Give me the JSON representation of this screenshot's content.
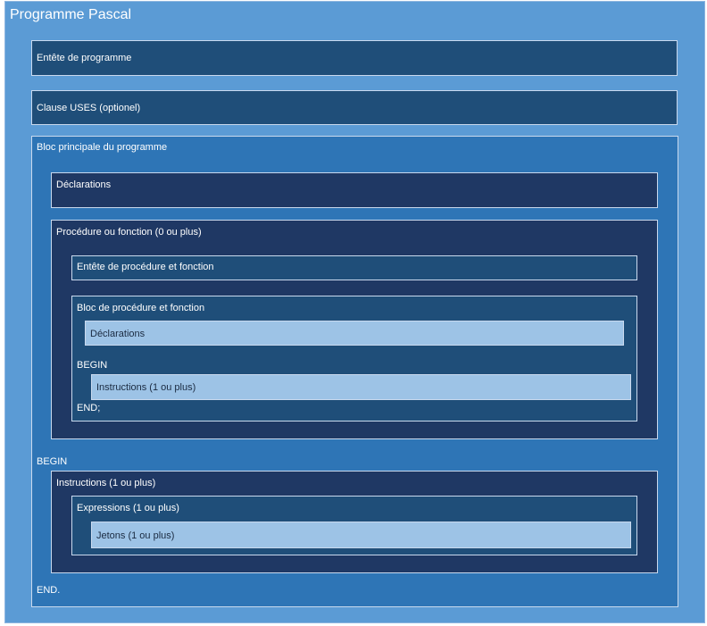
{
  "diagram": {
    "title": "Programme Pascal",
    "program_header": "Entête de programme",
    "uses_clause": "Clause USES (optionel)",
    "main_block": {
      "label": "Bloc principale du programme",
      "declarations": "Déclarations",
      "procedure": {
        "label": "Procédure ou fonction  (0 ou plus)",
        "header": "Entête de procédure et fonction",
        "block": {
          "label": "Bloc de procédure et fonction",
          "declarations": "Déclarations",
          "begin": "BEGIN",
          "instructions": "Instructions (1 ou plus)",
          "end": "END;"
        }
      },
      "begin": "BEGIN",
      "instructions": {
        "label": "Instructions (1 ou plus)",
        "expressions": {
          "label": "Expressions (1 ou plus)",
          "tokens": "Jetons (1 ou plus)"
        }
      },
      "end": "END."
    }
  }
}
